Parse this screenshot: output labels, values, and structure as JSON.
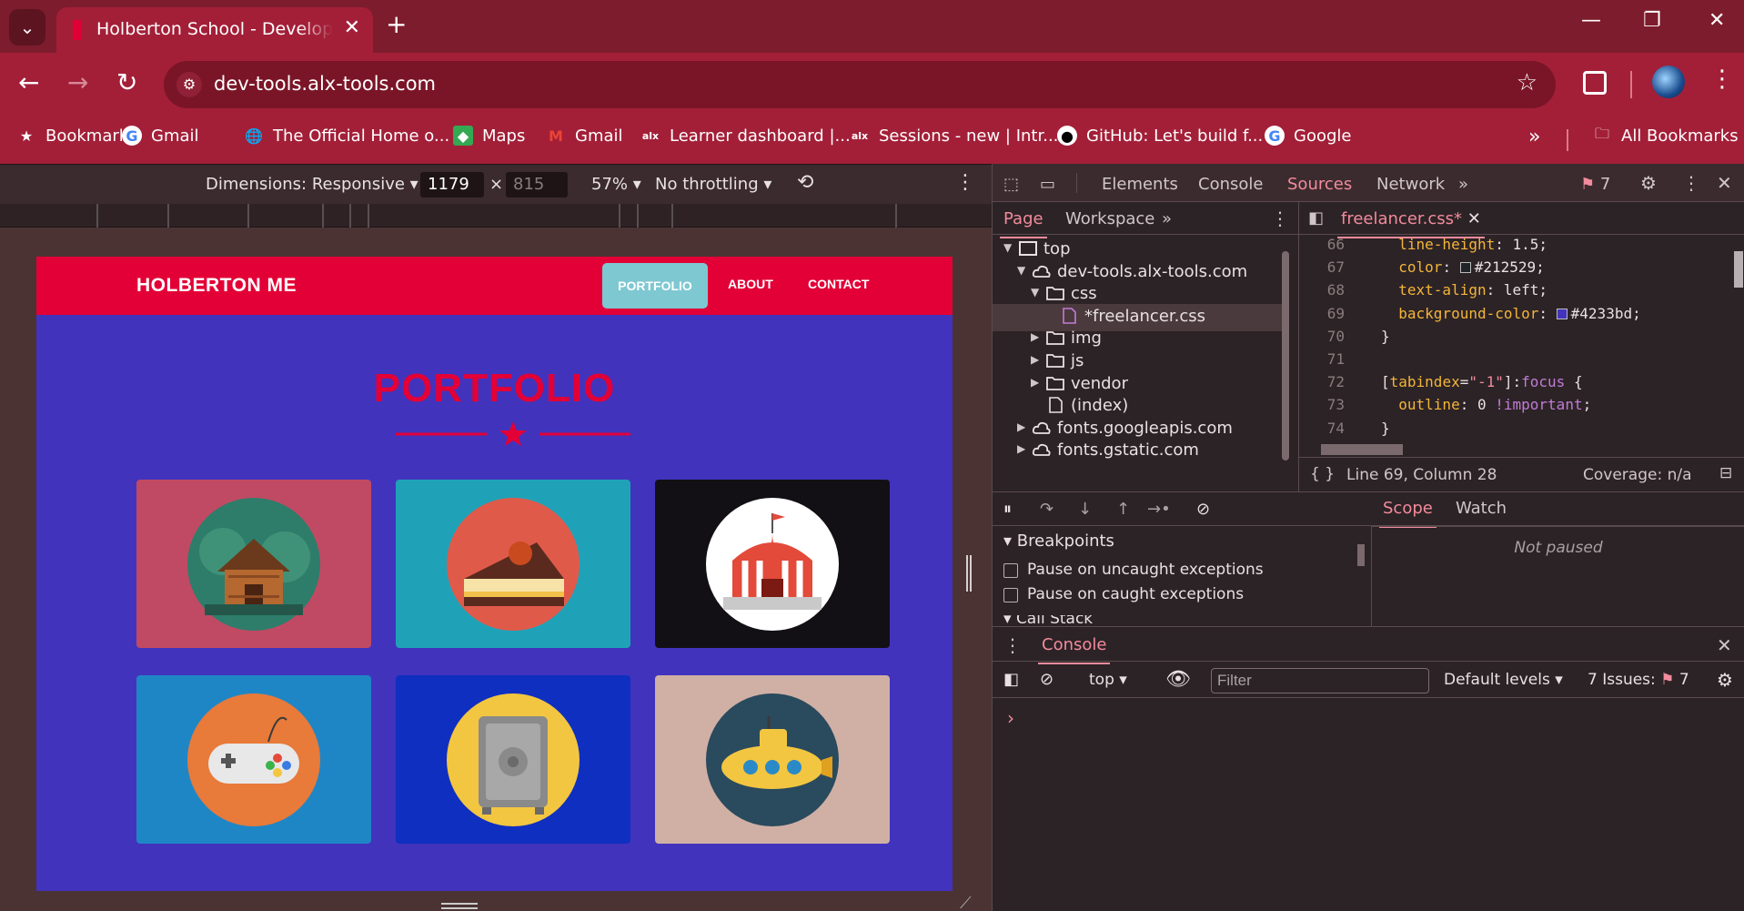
{
  "browser": {
    "tab_title": "Holberton School - Developer tools",
    "new_tab": "+",
    "url": "dev-tools.alx-tools.com",
    "bookmarks": [
      {
        "label": "Bookmarks",
        "icon": "star-icon"
      },
      {
        "label": "Gmail",
        "icon": "google-icon"
      },
      {
        "label": "The Official Home o...",
        "icon": "globe-icon"
      },
      {
        "label": "Maps",
        "icon": "maps-icon"
      },
      {
        "label": "Gmail",
        "icon": "gmail-icon"
      },
      {
        "label": "Learner dashboard |...",
        "icon": "alx-icon"
      },
      {
        "label": "Sessions - new | Intr...",
        "icon": "alx-icon"
      },
      {
        "label": "GitHub: Let's build f...",
        "icon": "github-icon"
      },
      {
        "label": "Google",
        "icon": "google-icon"
      }
    ],
    "overflow": "»",
    "all_bookmarks": "All Bookmarks"
  },
  "device_toolbar": {
    "dimensions": "Dimensions: Responsive",
    "width": "1179",
    "height": "815",
    "times": "×",
    "zoom": "57%",
    "throttling": "No throttling"
  },
  "site": {
    "brand": "HOLBERTON ME",
    "nav": [
      "PORTFOLIO",
      "ABOUT",
      "CONTACT"
    ],
    "title": "PORTFOLIO",
    "colors": {
      "nav": "#e30036",
      "bg": "#4233bd",
      "accent": "#7ec8d2"
    },
    "cards": [
      {
        "name": "cabin",
        "bg": "#c04a63",
        "circle": "#2e7d6a"
      },
      {
        "name": "cake",
        "bg": "#1fa2b8",
        "circle": "#e05a4a"
      },
      {
        "name": "circus",
        "bg": "#121015",
        "circle": "#ffffff"
      },
      {
        "name": "game",
        "bg": "#1f86c6",
        "circle": "#e87a3a"
      },
      {
        "name": "safe",
        "bg": "#0f2fc0",
        "circle": "#f2c640"
      },
      {
        "name": "submarine",
        "bg": "#d0b0a4",
        "circle": "#2a4a5e"
      }
    ]
  },
  "devtools": {
    "tabs": [
      "Elements",
      "Console",
      "Sources",
      "Network"
    ],
    "active_tab": "Sources",
    "issues_count": "7",
    "nav_tabs": [
      "Page",
      "Workspace"
    ],
    "tree": [
      {
        "label": "top",
        "depth": 0,
        "kind": "frame",
        "arrow": "▼"
      },
      {
        "label": "dev-tools.alx-tools.com",
        "depth": 1,
        "kind": "cloud",
        "arrow": "▼"
      },
      {
        "label": "css",
        "depth": 2,
        "kind": "folder",
        "arrow": "▼"
      },
      {
        "label": "*freelancer.css",
        "depth": 3,
        "kind": "file",
        "arrow": ""
      },
      {
        "label": "img",
        "depth": 2,
        "kind": "folder",
        "arrow": "▶"
      },
      {
        "label": "js",
        "depth": 2,
        "kind": "folder",
        "arrow": "▶"
      },
      {
        "label": "vendor",
        "depth": 2,
        "kind": "folder",
        "arrow": "▶"
      },
      {
        "label": "(index)",
        "depth": 2,
        "kind": "file",
        "arrow": ""
      },
      {
        "label": "fonts.googleapis.com",
        "depth": 1,
        "kind": "cloud",
        "arrow": "▶"
      },
      {
        "label": "fonts.gstatic.com",
        "depth": 1,
        "kind": "cloud",
        "arrow": "▶"
      }
    ],
    "editor_file": "freelancer.css*",
    "code": [
      {
        "n": "66",
        "html": "  <span class='p'>line-height</span>: <span class='v'>1.5</span>;"
      },
      {
        "n": "67",
        "html": "  <span class='p'>color</span>: <span class='swatch' style='background:#212529'></span><span class='v'>#212529</span>;"
      },
      {
        "n": "68",
        "html": "  <span class='p'>text-align</span>: <span class='v'>left</span>;"
      },
      {
        "n": "69",
        "html": "  <span class='p'>background-color</span>: <span class='swatch' style='background:#4233bd'></span><span class='v'>#4233bd</span>;"
      },
      {
        "n": "70",
        "html": "}"
      },
      {
        "n": "71",
        "html": ""
      },
      {
        "n": "72",
        "html": "[<span class='p'>tabindex</span>=<span class='str'>\"-1\"</span>]:<span class='kw'>focus</span> {"
      },
      {
        "n": "73",
        "html": "  <span class='p'>outline</span>: <span class='v'>0</span> <span class='kw'>!important</span>;"
      },
      {
        "n": "74",
        "html": "}"
      }
    ],
    "status": {
      "position": "Line 69, Column 28",
      "coverage": "Coverage: n/a"
    },
    "breakpoints": {
      "title": "Breakpoints",
      "uncaught": "Pause on uncaught exceptions",
      "caught": "Pause on caught exceptions",
      "call_stack": "Call Stack"
    },
    "scope": {
      "tabs": [
        "Scope",
        "Watch"
      ],
      "not_paused": "Not paused"
    },
    "console": {
      "tab": "Console",
      "context": "top",
      "filter_placeholder": "Filter",
      "levels": "Default levels",
      "issues": "7 Issues:",
      "issues_count": "7",
      "prompt": "›"
    }
  }
}
